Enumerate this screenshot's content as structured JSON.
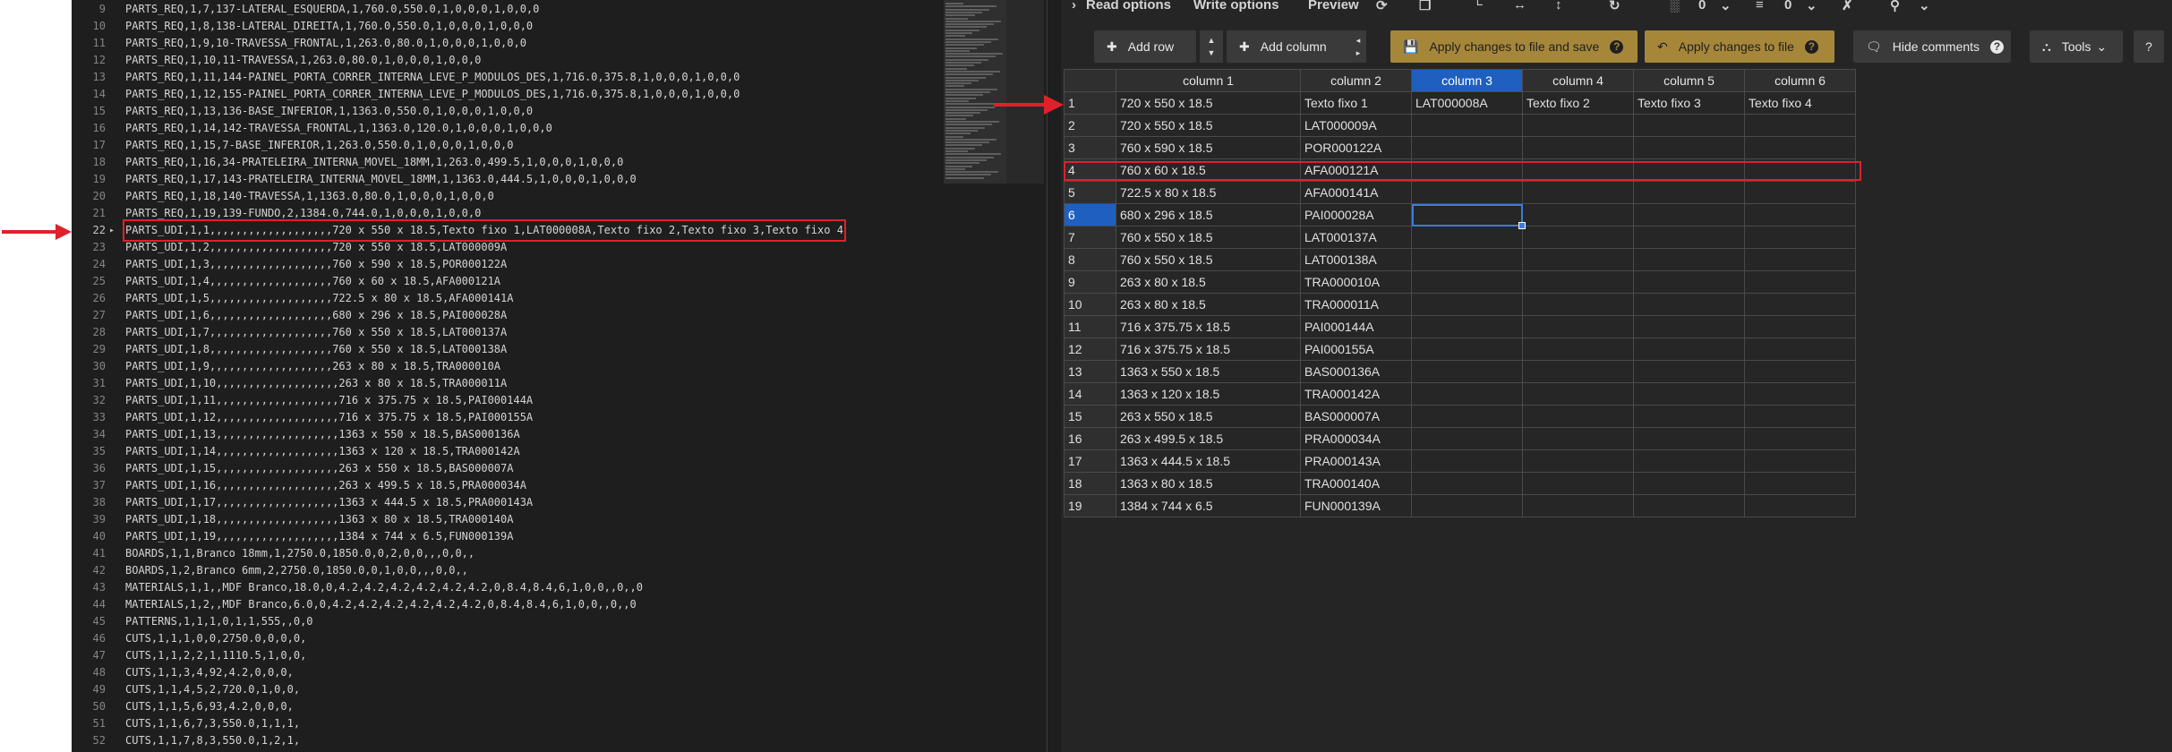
{
  "editor": {
    "lines": [
      {
        "n": "9",
        "text": "PARTS_REQ,1,7,137-LATERAL_ESQUERDA,1,760.0,550.0,1,0,0,0,1,0,0,0"
      },
      {
        "n": "10",
        "text": "PARTS_REQ,1,8,138-LATERAL_DIREITA,1,760.0,550.0,1,0,0,0,1,0,0,0"
      },
      {
        "n": "11",
        "text": "PARTS_REQ,1,9,10-TRAVESSA_FRONTAL,1,263.0,80.0,1,0,0,0,1,0,0,0"
      },
      {
        "n": "12",
        "text": "PARTS_REQ,1,10,11-TRAVESSA,1,263.0,80.0,1,0,0,0,1,0,0,0"
      },
      {
        "n": "13",
        "text": "PARTS_REQ,1,11,144-PAINEL_PORTA_CORRER_INTERNA_LEVE_P_MODULOS_DES,1,716.0,375.8,1,0,0,0,1,0,0,0"
      },
      {
        "n": "14",
        "text": "PARTS_REQ,1,12,155-PAINEL_PORTA_CORRER_INTERNA_LEVE_P_MODULOS_DES,1,716.0,375.8,1,0,0,0,1,0,0,0"
      },
      {
        "n": "15",
        "text": "PARTS_REQ,1,13,136-BASE_INFERIOR,1,1363.0,550.0,1,0,0,0,1,0,0,0"
      },
      {
        "n": "16",
        "text": "PARTS_REQ,1,14,142-TRAVESSA_FRONTAL,1,1363.0,120.0,1,0,0,0,1,0,0,0"
      },
      {
        "n": "17",
        "text": "PARTS_REQ,1,15,7-BASE_INFERIOR,1,263.0,550.0,1,0,0,0,1,0,0,0"
      },
      {
        "n": "18",
        "text": "PARTS_REQ,1,16,34-PRATELEIRA_INTERNA_MOVEL_18MM,1,263.0,499.5,1,0,0,0,1,0,0,0"
      },
      {
        "n": "19",
        "text": "PARTS_REQ,1,17,143-PRATELEIRA_INTERNA_MOVEL_18MM,1,1363.0,444.5,1,0,0,0,1,0,0,0"
      },
      {
        "n": "20",
        "text": "PARTS_REQ,1,18,140-TRAVESSA,1,1363.0,80.0,1,0,0,0,1,0,0,0"
      },
      {
        "n": "21",
        "text": "PARTS_REQ,1,19,139-FUNDO,2,1384.0,744.0,1,0,0,0,1,0,0,0"
      },
      {
        "n": "22",
        "text": "PARTS_UDI,1,1,,,,,,,,,,,,,,,,,,,720 x 550 x 18.5,Texto fixo 1,LAT000008A,Texto fixo 2,Texto fixo 3,Texto fixo 4",
        "highlight": true
      },
      {
        "n": "23",
        "text": "PARTS_UDI,1,2,,,,,,,,,,,,,,,,,,,720 x 550 x 18.5,LAT000009A"
      },
      {
        "n": "24",
        "text": "PARTS_UDI,1,3,,,,,,,,,,,,,,,,,,,760 x 590 x 18.5,POR000122A"
      },
      {
        "n": "25",
        "text": "PARTS_UDI,1,4,,,,,,,,,,,,,,,,,,,760 x 60 x 18.5,AFA000121A"
      },
      {
        "n": "26",
        "text": "PARTS_UDI,1,5,,,,,,,,,,,,,,,,,,,722.5 x 80 x 18.5,AFA000141A"
      },
      {
        "n": "27",
        "text": "PARTS_UDI,1,6,,,,,,,,,,,,,,,,,,,680 x 296 x 18.5,PAI000028A"
      },
      {
        "n": "28",
        "text": "PARTS_UDI,1,7,,,,,,,,,,,,,,,,,,,760 x 550 x 18.5,LAT000137A"
      },
      {
        "n": "29",
        "text": "PARTS_UDI,1,8,,,,,,,,,,,,,,,,,,,760 x 550 x 18.5,LAT000138A"
      },
      {
        "n": "30",
        "text": "PARTS_UDI,1,9,,,,,,,,,,,,,,,,,,,263 x 80 x 18.5,TRA000010A"
      },
      {
        "n": "31",
        "text": "PARTS_UDI,1,10,,,,,,,,,,,,,,,,,,,263 x 80 x 18.5,TRA000011A"
      },
      {
        "n": "32",
        "text": "PARTS_UDI,1,11,,,,,,,,,,,,,,,,,,,716 x 375.75 x 18.5,PAI000144A"
      },
      {
        "n": "33",
        "text": "PARTS_UDI,1,12,,,,,,,,,,,,,,,,,,,716 x 375.75 x 18.5,PAI000155A"
      },
      {
        "n": "34",
        "text": "PARTS_UDI,1,13,,,,,,,,,,,,,,,,,,,1363 x 550 x 18.5,BAS000136A"
      },
      {
        "n": "35",
        "text": "PARTS_UDI,1,14,,,,,,,,,,,,,,,,,,,1363 x 120 x 18.5,TRA000142A"
      },
      {
        "n": "36",
        "text": "PARTS_UDI,1,15,,,,,,,,,,,,,,,,,,,263 x 550 x 18.5,BAS000007A"
      },
      {
        "n": "37",
        "text": "PARTS_UDI,1,16,,,,,,,,,,,,,,,,,,,263 x 499.5 x 18.5,PRA000034A"
      },
      {
        "n": "38",
        "text": "PARTS_UDI,1,17,,,,,,,,,,,,,,,,,,,1363 x 444.5 x 18.5,PRA000143A"
      },
      {
        "n": "39",
        "text": "PARTS_UDI,1,18,,,,,,,,,,,,,,,,,,,1363 x 80 x 18.5,TRA000140A"
      },
      {
        "n": "40",
        "text": "PARTS_UDI,1,19,,,,,,,,,,,,,,,,,,,1384 x 744 x 6.5,FUN000139A"
      },
      {
        "n": "41",
        "text": "BOARDS,1,1,Branco 18mm,1,2750.0,1850.0,0,2,0,0,,,0,0,,"
      },
      {
        "n": "42",
        "text": "BOARDS,1,2,Branco 6mm,2,2750.0,1850.0,0,1,0,0,,,0,0,,"
      },
      {
        "n": "43",
        "text": "MATERIALS,1,1,,MDF Branco,18.0,0,4.2,4.2,4.2,4.2,4.2,4.2,0,8.4,8.4,6,1,0,0,,0,,0"
      },
      {
        "n": "44",
        "text": "MATERIALS,1,2,,MDF Branco,6.0,0,4.2,4.2,4.2,4.2,4.2,4.2,0,8.4,8.4,6,1,0,0,,0,,0"
      },
      {
        "n": "45",
        "text": "PATTERNS,1,1,1,0,1,1,555,,0,0"
      },
      {
        "n": "46",
        "text": "CUTS,1,1,1,0,0,2750.0,0,0,0,"
      },
      {
        "n": "47",
        "text": "CUTS,1,1,2,2,1,1110.5,1,0,0,"
      },
      {
        "n": "48",
        "text": "CUTS,1,1,3,4,92,4.2,0,0,0,"
      },
      {
        "n": "49",
        "text": "CUTS,1,1,4,5,2,720.0,1,0,0,"
      },
      {
        "n": "50",
        "text": "CUTS,1,1,5,6,93,4.2,0,0,0,"
      },
      {
        "n": "51",
        "text": "CUTS,1,1,6,7,3,550.0,1,1,1,"
      },
      {
        "n": "52",
        "text": "CUTS,1,1,7,8,3,550.0,1,2,1,"
      }
    ]
  },
  "panel": {
    "options": {
      "read": "Read options",
      "write": "Write options",
      "preview": "Preview",
      "count1": "0",
      "count2": "0"
    },
    "toolbar": {
      "add_row": "Add row",
      "add_column": "Add column",
      "apply_save": "Apply changes to file and save",
      "apply_file": "Apply changes to file",
      "hide_comments": "Hide comments",
      "tools": "Tools"
    },
    "icons": {
      "plus": "plus-icon",
      "save": "save-icon",
      "undo": "undo-icon",
      "comment": "comment-icon",
      "help": "help-icon",
      "tools": "tools-icon"
    },
    "colors": {
      "accent_blue": "#1f5fbf",
      "gold_button": "#a6873a",
      "highlight_red": "#e0202a"
    },
    "table": {
      "columns": [
        "column 1",
        "column 2",
        "column 3",
        "column 4",
        "column 5",
        "column 6"
      ],
      "selected_column": 2,
      "selected_row": 6,
      "rows": [
        [
          "1",
          "720 x 550 x 18.5",
          "Texto fixo 1",
          "LAT000008A",
          "Texto fixo 2",
          "Texto fixo 3",
          "Texto fixo 4"
        ],
        [
          "2",
          "720 x 550 x 18.5",
          "LAT000009A",
          "",
          "",
          "",
          ""
        ],
        [
          "3",
          "760 x 590 x 18.5",
          "POR000122A",
          "",
          "",
          "",
          ""
        ],
        [
          "4",
          "760 x 60 x 18.5",
          "AFA000121A",
          "",
          "",
          "",
          ""
        ],
        [
          "5",
          "722.5 x 80 x 18.5",
          "AFA000141A",
          "",
          "",
          "",
          ""
        ],
        [
          "6",
          "680 x 296 x 18.5",
          "PAI000028A",
          "",
          "",
          "",
          ""
        ],
        [
          "7",
          "760 x 550 x 18.5",
          "LAT000137A",
          "",
          "",
          "",
          ""
        ],
        [
          "8",
          "760 x 550 x 18.5",
          "LAT000138A",
          "",
          "",
          "",
          ""
        ],
        [
          "9",
          "263 x 80 x 18.5",
          "TRA000010A",
          "",
          "",
          "",
          ""
        ],
        [
          "10",
          "263 x 80 x 18.5",
          "TRA000011A",
          "",
          "",
          "",
          ""
        ],
        [
          "11",
          "716 x 375.75 x 18.5",
          "PAI000144A",
          "",
          "",
          "",
          ""
        ],
        [
          "12",
          "716 x 375.75 x 18.5",
          "PAI000155A",
          "",
          "",
          "",
          ""
        ],
        [
          "13",
          "1363 x 550 x 18.5",
          "BAS000136A",
          "",
          "",
          "",
          ""
        ],
        [
          "14",
          "1363 x 120 x 18.5",
          "TRA000142A",
          "",
          "",
          "",
          ""
        ],
        [
          "15",
          "263 x 550 x 18.5",
          "BAS000007A",
          "",
          "",
          "",
          ""
        ],
        [
          "16",
          "263 x 499.5 x 18.5",
          "PRA000034A",
          "",
          "",
          "",
          ""
        ],
        [
          "17",
          "1363 x 444.5 x 18.5",
          "PRA000143A",
          "",
          "",
          "",
          ""
        ],
        [
          "18",
          "1363 x 80 x 18.5",
          "TRA000140A",
          "",
          "",
          "",
          ""
        ],
        [
          "19",
          "1384 x 744 x 6.5",
          "FUN000139A",
          "",
          "",
          "",
          ""
        ]
      ]
    }
  }
}
